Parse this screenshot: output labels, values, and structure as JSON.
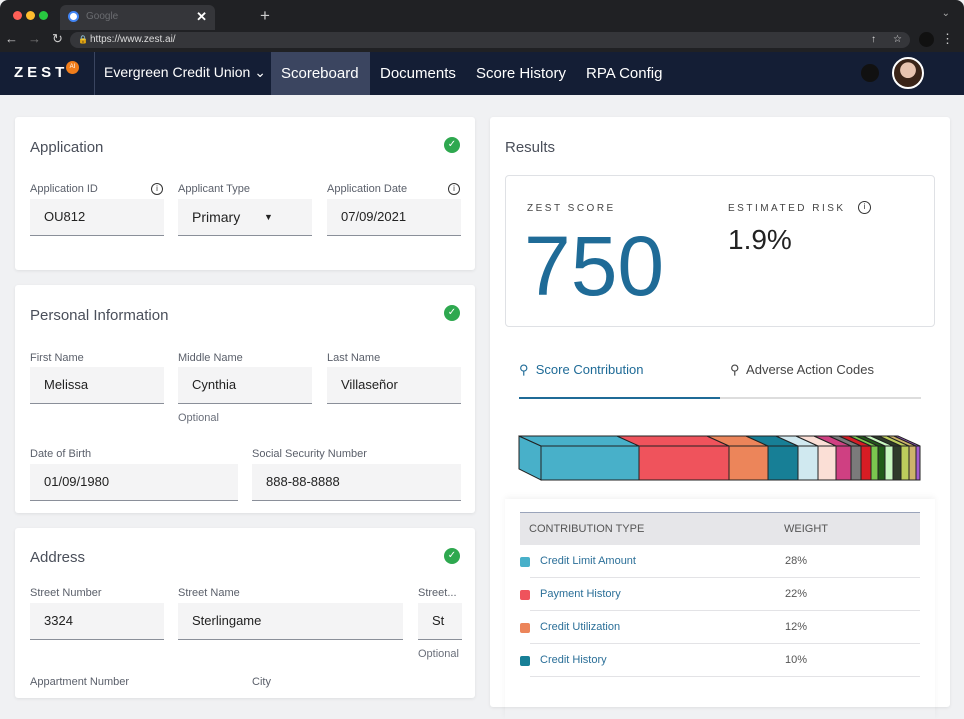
{
  "browser": {
    "url": "https://www.zest.ai/",
    "tab_title": "Google"
  },
  "nav": {
    "logo": "ZEST",
    "logo_badge": "AI",
    "org": "Evergreen Credit Union",
    "items": [
      "Scoreboard",
      "Documents",
      "Score History",
      "RPA Config"
    ],
    "active": "Scoreboard"
  },
  "application": {
    "title": "Application",
    "id_label": "Application ID",
    "id": "OU812",
    "type_label": "Applicant Type",
    "type": "Primary",
    "date_label": "Application Date",
    "date": "07/09/2021"
  },
  "personal": {
    "title": "Personal Information",
    "first_label": "First Name",
    "first": "Melissa",
    "middle_label": "Middle Name",
    "middle": "Cynthia",
    "middle_hint": "Optional",
    "last_label": "Last Name",
    "last": "Villaseñor",
    "dob_label": "Date of Birth",
    "dob": "01/09/1980",
    "ssn_label": "Social Security Number",
    "ssn": "888-88-8888"
  },
  "address": {
    "title": "Address",
    "num_label": "Street Number",
    "num": "3324",
    "name_label": "Street Name",
    "name": "Sterlingame",
    "suffix_label": "Street...",
    "suffix": "St",
    "suffix_hint": "Optional",
    "apt_label": "Appartment Number",
    "city_label": "City"
  },
  "results": {
    "title": "Results",
    "score_label": "ZEST SCORE",
    "score": "750",
    "risk_label": "ESTIMATED RISK",
    "risk": "1.9%",
    "tabs": [
      "Score Contribution",
      "Adverse Action Codes"
    ],
    "active_tab": "Score Contribution",
    "bar_colors": [
      "#48b0c9",
      "#ef535c",
      "#ec855a",
      "#177f96",
      "#d0e9f0",
      "#fbdfd6",
      "#cf4082",
      "#7b7b7b",
      "#d71d24",
      "#7ac74f",
      "#215c19",
      "#c8f7c0",
      "#2e3a2a",
      "#bdcc5c",
      "#cdb36b",
      "#a25bcf"
    ],
    "table": {
      "headers": [
        "CONTRIBUTION TYPE",
        "WEIGHT"
      ],
      "rows": [
        {
          "name": "Credit Limit Amount",
          "weight": "28%",
          "color": "#48b0c9"
        },
        {
          "name": "Payment History",
          "weight": "22%",
          "color": "#ef535c"
        },
        {
          "name": "Credit Utilization",
          "weight": "12%",
          "color": "#ec855a"
        },
        {
          "name": "Credit History",
          "weight": "10%",
          "color": "#177f96"
        }
      ]
    }
  }
}
